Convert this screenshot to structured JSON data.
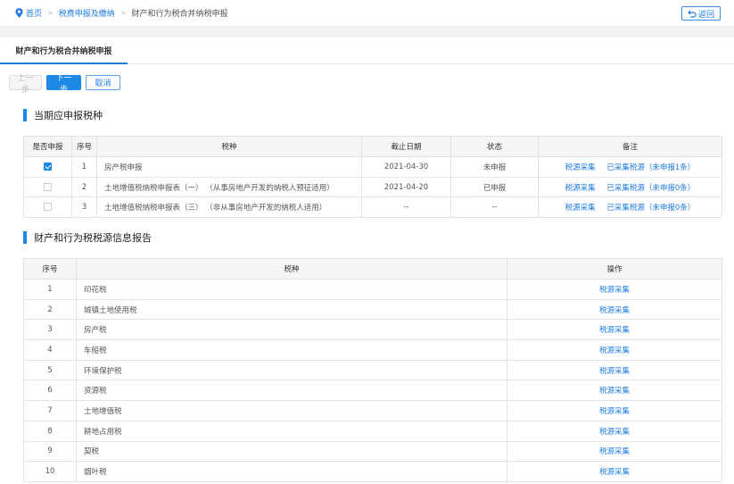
{
  "breadcrumb": {
    "home": "首页",
    "level2": "税费申报及缴纳",
    "current": "财产和行为税合并纳税申报"
  },
  "back_button": "返回",
  "tab": "财产和行为税合并纳税申报",
  "buttons": {
    "prev": "上一步",
    "next": "下一步",
    "cancel": "取消"
  },
  "section1": {
    "title": "当期应申报税种",
    "headers": [
      "是否申报",
      "序号",
      "税种",
      "截止日期",
      "状态",
      "备注"
    ],
    "rows": [
      {
        "checked": true,
        "no": "1",
        "tax": "房产税申报",
        "deadline": "2021-04-30",
        "status": "未申报",
        "link1": "税源采集",
        "link2": "已采集税源（未申报1条）"
      },
      {
        "checked": false,
        "no": "2",
        "tax": "土地增值税纳税申报表（一） （从事房地产开发的纳税人预征适用）",
        "deadline": "2021-04-20",
        "status": "已申报",
        "link1": "税源采集",
        "link2": "已采集税源（未申报0条）"
      },
      {
        "checked": false,
        "no": "3",
        "tax": "土地增值税纳税申报表（三） （非从事房地产开发的纳税人适用）",
        "deadline": "--",
        "status": "--",
        "link1": "税源采集",
        "link2": "已采集税源（未申报0条）"
      }
    ]
  },
  "section2": {
    "title": "财产和行为税税源信息报告",
    "headers": [
      "序号",
      "税种",
      "操作"
    ],
    "rows": [
      {
        "no": "1",
        "tax": "印花税",
        "action": "税源采集"
      },
      {
        "no": "2",
        "tax": "城镇土地使用税",
        "action": "税源采集"
      },
      {
        "no": "3",
        "tax": "房产税",
        "action": "税源采集"
      },
      {
        "no": "4",
        "tax": "车船税",
        "action": "税源采集"
      },
      {
        "no": "5",
        "tax": "环境保护税",
        "action": "税源采集"
      },
      {
        "no": "6",
        "tax": "资源税",
        "action": "税源采集"
      },
      {
        "no": "7",
        "tax": "土地增值税",
        "action": "税源采集"
      },
      {
        "no": "8",
        "tax": "耕地占用税",
        "action": "税源采集"
      },
      {
        "no": "9",
        "tax": "契税",
        "action": "税源采集"
      },
      {
        "no": "10",
        "tax": "烟叶税",
        "action": "税源采集"
      }
    ]
  }
}
